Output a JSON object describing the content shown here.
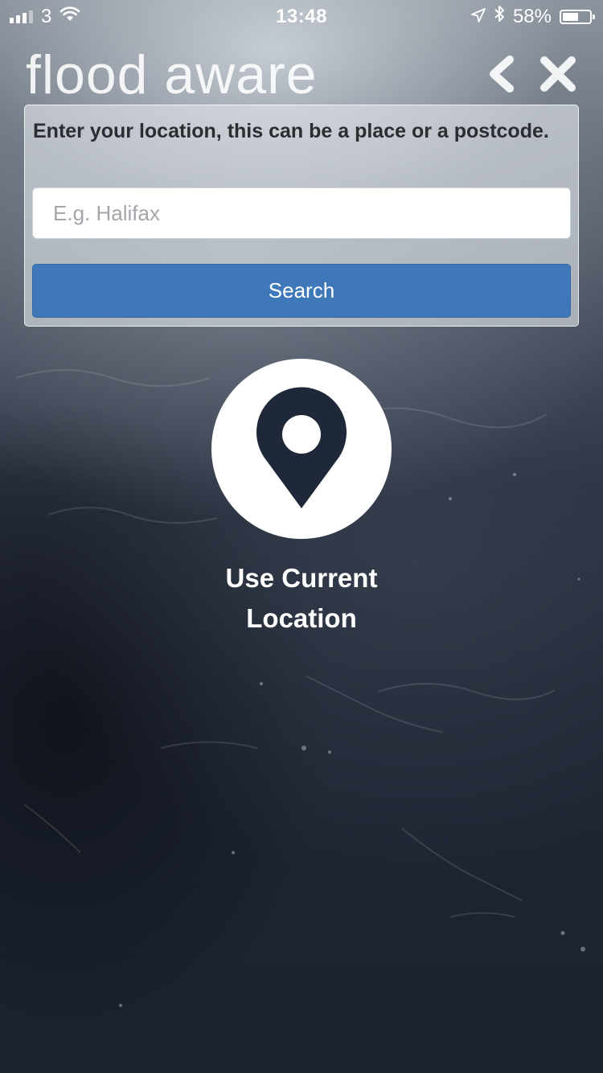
{
  "status_bar": {
    "carrier": "3",
    "time": "13:48",
    "battery_percent": "58%",
    "battery_level": 0.58,
    "icons": [
      "signal-icon",
      "wifi-icon",
      "location-arrow-icon",
      "bluetooth-icon",
      "battery-icon"
    ]
  },
  "header": {
    "title": "flood aware",
    "back_icon": "chevron-left-icon",
    "close_icon": "close-icon"
  },
  "search": {
    "label": "Enter your location, this can be a place or a postcode.",
    "placeholder": "E.g. Halifax",
    "value": "",
    "button_label": "Search",
    "button_color": "#3f78b9"
  },
  "location": {
    "icon": "map-pin-icon",
    "label": "Use Current Location"
  }
}
